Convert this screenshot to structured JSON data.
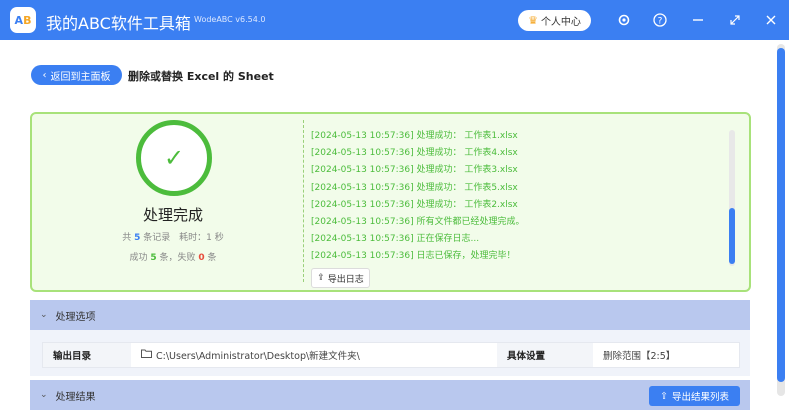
{
  "app": {
    "title": "我的ABC软件工具箱",
    "version": "WodeABC v6.54.0",
    "logo_text_a": "A",
    "logo_text_b": "B",
    "vip_label": "个人中心"
  },
  "nav": {
    "back_label": "返回到主面板",
    "page_title": "删除或替换 Excel 的 Sheet"
  },
  "result": {
    "status_text": "处理完成",
    "total_prefix": "共",
    "total_count": "5",
    "total_suffix": "条记录",
    "time_label": "耗时：1 秒",
    "success_prefix": "成功",
    "success_count": "5",
    "success_mid": "条，失败",
    "fail_count": "0",
    "fail_suffix": "条",
    "logs": [
      "[2024-05-13 10:57:36] 处理成功： 工作表1.xlsx",
      "[2024-05-13 10:57:36] 处理成功： 工作表4.xlsx",
      "[2024-05-13 10:57:36] 处理成功： 工作表3.xlsx",
      "[2024-05-13 10:57:36] 处理成功： 工作表5.xlsx",
      "[2024-05-13 10:57:36] 处理成功： 工作表2.xlsx",
      "[2024-05-13 10:57:36] 所有文件都已经处理完成。",
      "[2024-05-13 10:57:36] 正在保存日志...",
      "[2024-05-13 10:57:36] 日志已保存，处理完毕！"
    ],
    "export_log_label": "导出日志"
  },
  "options": {
    "section_label": "处理选项",
    "output_dir_label": "输出目录",
    "output_dir_value": "C:\\Users\\Administrator\\Desktop\\新建文件夹\\",
    "settings_label": "具体设置",
    "settings_value": "删除范围【2:5】"
  },
  "results_section": {
    "section_label": "处理结果",
    "export_label": "导出结果列表"
  },
  "colors": {
    "accent": "#3b7ff2",
    "success": "#4cbc3c",
    "fail": "#e74c3c"
  }
}
